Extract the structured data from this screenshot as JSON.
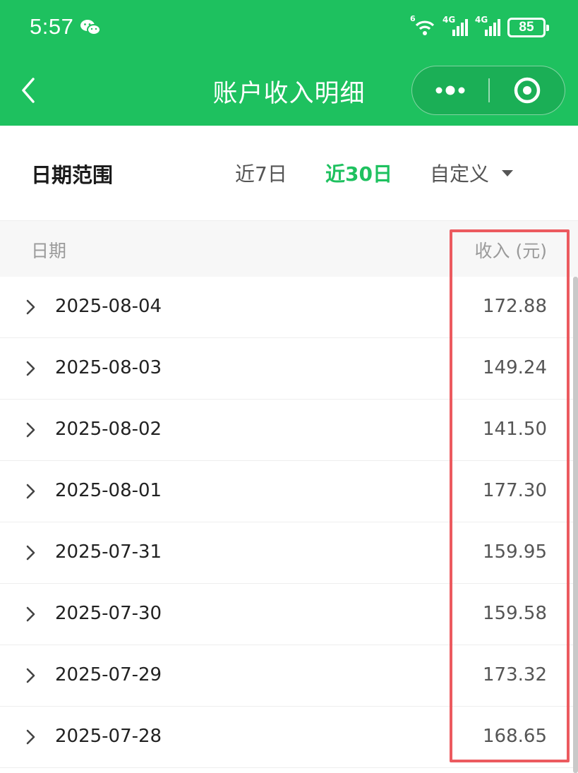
{
  "status_bar": {
    "time": "5:57",
    "network_badge": "6",
    "signal_1_label": "4G",
    "signal_2_label": "4G",
    "battery": "85"
  },
  "nav": {
    "title": "账户收入明细"
  },
  "filter": {
    "label": "日期范围",
    "options": [
      {
        "label": "近7日",
        "active": false
      },
      {
        "label": "近30日",
        "active": true
      },
      {
        "label": "自定义",
        "active": false
      }
    ]
  },
  "table": {
    "columns": {
      "date": "日期",
      "amount": "收入 (元)"
    },
    "rows": [
      {
        "date": "2025-08-04",
        "amount": "172.88"
      },
      {
        "date": "2025-08-03",
        "amount": "149.24"
      },
      {
        "date": "2025-08-02",
        "amount": "141.50"
      },
      {
        "date": "2025-08-01",
        "amount": "177.30"
      },
      {
        "date": "2025-07-31",
        "amount": "159.95"
      },
      {
        "date": "2025-07-30",
        "amount": "159.58"
      },
      {
        "date": "2025-07-29",
        "amount": "173.32"
      },
      {
        "date": "2025-07-28",
        "amount": "168.65"
      }
    ]
  },
  "colors": {
    "brand": "#1ec15f",
    "highlight": "#ec5a5f"
  }
}
